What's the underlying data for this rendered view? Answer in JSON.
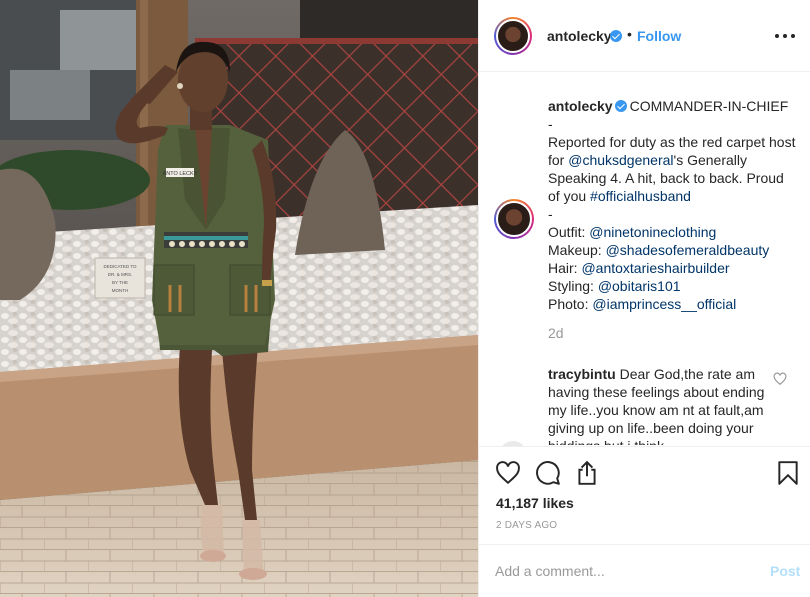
{
  "post": {
    "username": "antolecky",
    "follow_label": "Follow",
    "dot": "•",
    "caption": {
      "username": "antolecky",
      "title": "COMMANDER-IN-CHIEF",
      "dash1": "-",
      "text1": "Reported for duty as the red carpet host for ",
      "mention1": "@chuksdgeneral",
      "text2": "'s Generally Speaking 4. A hit, back to back. Proud of you ",
      "hashtag": "#officialhusband",
      "dash2": "-",
      "credits": [
        {
          "label": "Outfit: ",
          "handle": "@ninetonineclothing"
        },
        {
          "label": "Makeup: ",
          "handle": "@shadesofemeraldbeauty"
        },
        {
          "label": "Hair: ",
          "handle": "@antoxtarieshairbuilder"
        },
        {
          "label": "Styling: ",
          "handle": "@obitaris101"
        },
        {
          "label": "Photo: ",
          "handle": "@iamprincess__official"
        }
      ],
      "time": "2d"
    },
    "comment": {
      "username": "tracybintu",
      "text": "Dear God,the rate am having these feelings about ending my life..you know am nt at fault,am giving up on life..been doing your biddings but i think"
    },
    "likes": "41,187 likes",
    "date": "2 DAYS AGO",
    "comment_placeholder": "Add a comment...",
    "post_label": "Post"
  },
  "photo": {
    "tag_text": "ANTO LECKY",
    "plaque_lines": [
      "DEDICATED TO",
      "DR. & MRS.",
      "BY THE",
      "MONTH"
    ]
  },
  "colors": {
    "link": "#003569",
    "follow": "#3897f0",
    "muted": "#999999",
    "post_disabled": "#b2dffc"
  },
  "icons": [
    "verified-badge-icon",
    "more-options-icon",
    "heart-icon",
    "comment-icon",
    "share-icon",
    "bookmark-icon"
  ]
}
